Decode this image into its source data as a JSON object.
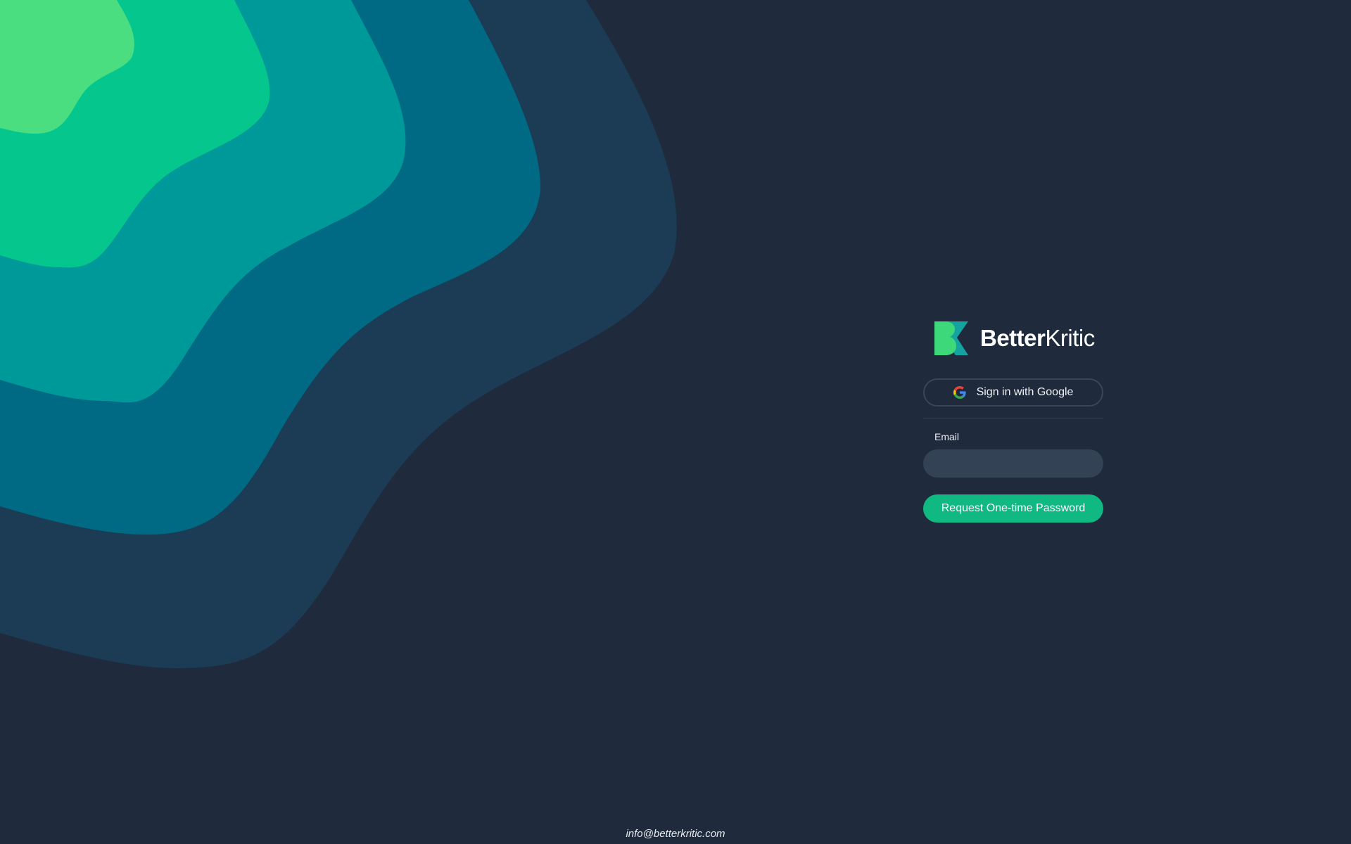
{
  "brand": {
    "name_bold": "Better",
    "name_light": "Kritic",
    "logo_icon": "betterkritic-logo-icon"
  },
  "login": {
    "google_button_label": "Sign in with Google",
    "google_icon": "google-icon",
    "email_label": "Email",
    "email_value": "",
    "email_placeholder": "",
    "otp_button_label": "Request One-time Password"
  },
  "footer": {
    "contact_email": "info@betterkritic.com"
  },
  "colors": {
    "background": "#1f2a3c",
    "wave_1": "#4ade80",
    "wave_2": "#05c78e",
    "wave_3": "#009999",
    "wave_4": "#006a84",
    "wave_5": "#1b3c54",
    "accent": "#10b981",
    "input_background": "#344256"
  }
}
